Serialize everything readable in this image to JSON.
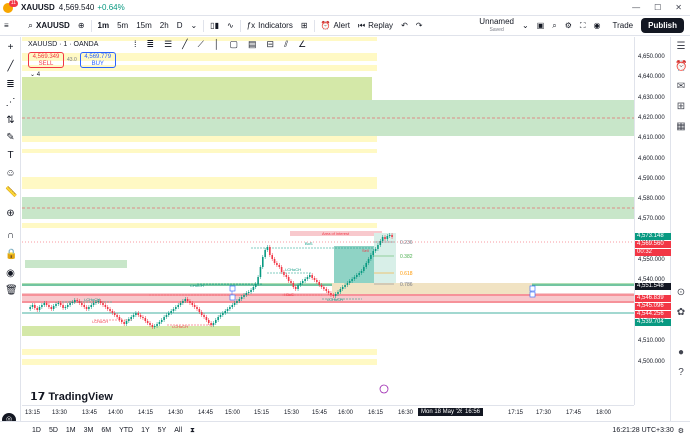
{
  "titlebar": {
    "symbol": "XAUUSD",
    "price": "4,569.540",
    "change": "+0.64%",
    "badge": "11"
  },
  "toolbar": {
    "symbol": "XAUUSD",
    "intervals": [
      {
        "label": "1m",
        "active": true
      },
      {
        "label": "5m",
        "active": false
      },
      {
        "label": "15m",
        "active": false
      },
      {
        "label": "2h",
        "active": false
      },
      {
        "label": "D",
        "active": false
      }
    ],
    "indicators": "Indicators",
    "alert": "Alert",
    "replay": "Replay",
    "layout_name": "Unnamed",
    "layout_status": "Saved",
    "trade": "Trade",
    "publish": "Publish"
  },
  "legend": {
    "title": "XAUUSD · 1 · OANDA",
    "sell_price": "4,569.349",
    "sell_label": "SELL",
    "spread": "43.0",
    "buy_price": "4,569.779",
    "buy_label": "BUY",
    "collapsed_count": "4"
  },
  "price_axis": {
    "labels": [
      "4,650.000",
      "4,640.000",
      "4,630.000",
      "4,620.000",
      "4,610.000",
      "4,600.000",
      "4,590.000",
      "4,580.000",
      "4,570.000",
      "4,560.000",
      "4,550.000",
      "4,540.000",
      "4,530.000",
      "4,520.000",
      "4,510.000",
      "4,500.000"
    ],
    "badges": [
      {
        "text": "4,573.148",
        "color": "#089981"
      },
      {
        "text": "4,569.560",
        "color": "#f23645"
      },
      {
        "text": "00:32",
        "color": "#f23645"
      },
      {
        "text": "4,551.548",
        "color": "#131722"
      },
      {
        "text": "4,546.839",
        "color": "#f23645"
      },
      {
        "text": "4,545.096",
        "color": "#f23645"
      },
      {
        "text": "4,544.256",
        "color": "#f23645"
      },
      {
        "text": "4,539.704",
        "color": "#089981"
      }
    ]
  },
  "time_axis": {
    "labels": [
      "13:15",
      "13:30",
      "13:45",
      "14:00",
      "14:15",
      "14:30",
      "14:45",
      "15:00",
      "15:15",
      "15:30",
      "15:45",
      "16:00",
      "16:15",
      "16:30",
      "Mon 18 May '26",
      "16:56",
      "17:15",
      "17:30",
      "17:45",
      "18:00",
      "18:15",
      "18:30"
    ]
  },
  "annotations": {
    "area_of_interest": "Area of interest",
    "fib": [
      "0.236",
      "0.382",
      "0.618",
      "0.786"
    ],
    "choch": "CHoCH",
    "i_choch": "i-CHoCH",
    "bos": "BoS",
    "i_bos": "i-BoS",
    "sell": "Sell"
  },
  "bottombar": {
    "ranges": [
      "1D",
      "5D",
      "1M",
      "3M",
      "6M",
      "YTD",
      "1Y",
      "5Y",
      "All"
    ],
    "clock": "16:21:28 UTC+3:30"
  },
  "brand": {
    "logo_text": "TradingView"
  },
  "colors": {
    "bull": "#089981",
    "bear": "#f23645",
    "demand": "#c8e6c9",
    "supply_yellow": "#fff9c4"
  }
}
